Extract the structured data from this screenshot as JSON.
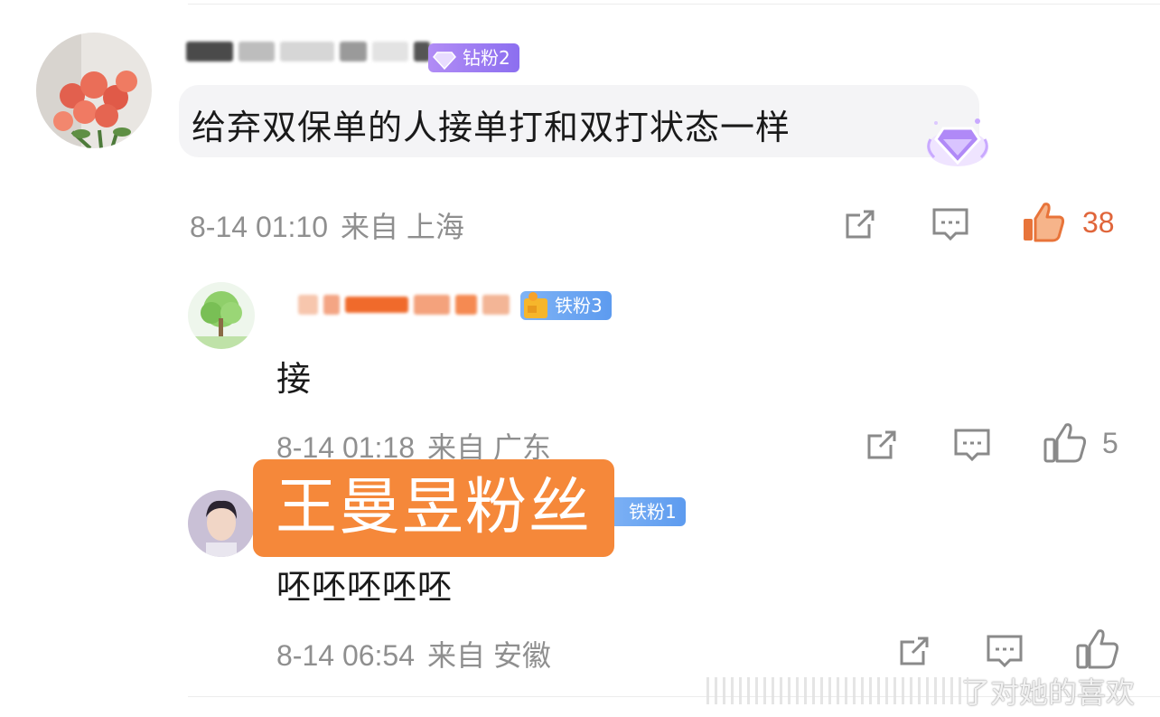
{
  "colors": {
    "accent_orange": "#f5883a",
    "like_active": "#e8743a",
    "meta_gray": "#8f8f8f",
    "badge_purple": "#9b7df2",
    "badge_blue": "#6ba6f2"
  },
  "comments": [
    {
      "username": "",
      "badge": "钻粉2",
      "text": "给弃双保单的人接单打和双打状态一样",
      "date": "8-14 01:10",
      "location": "来自 上海",
      "like_count": "38",
      "liked": true
    },
    {
      "username": "",
      "badge": "铁粉3",
      "text": "接",
      "date": "8-14 01:18",
      "location": "来自 广东",
      "like_count": "5",
      "liked": false
    },
    {
      "username": "",
      "badge": "铁粉1",
      "text": "呸呸呸呸呸",
      "date": "8-14 06:54",
      "location": "来自 安徽",
      "like_count": "",
      "liked": false
    }
  ],
  "overlay_label": "王曼昱粉丝",
  "watermark": "了对她的喜欢",
  "icons": [
    "share-icon",
    "comment-icon",
    "thumbs-up-icon",
    "diamond-icon",
    "crown-icon"
  ]
}
